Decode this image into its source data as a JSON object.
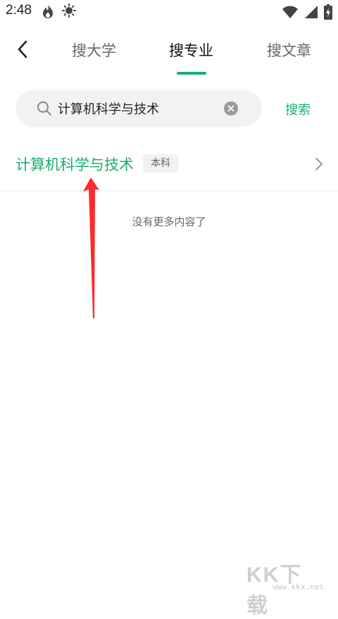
{
  "status_bar": {
    "time": "2:48"
  },
  "nav": {
    "tabs": [
      {
        "label": "搜大学",
        "active": false
      },
      {
        "label": "搜专业",
        "active": true
      },
      {
        "label": "搜文章",
        "active": false
      }
    ]
  },
  "search": {
    "value": "计算机科学与技术",
    "button_label": "搜索"
  },
  "results": [
    {
      "title": "计算机科学与技术",
      "badge": "本科"
    }
  ],
  "end_message": "没有更多内容了",
  "watermark": {
    "logo": "KK下载",
    "url": "www.kkx.net"
  },
  "colors": {
    "accent": "#1aae6f",
    "annotation": "#ff2a2a"
  },
  "icons": {
    "status_left": [
      "flame-icon",
      "brightness-icon"
    ],
    "status_right": [
      "wifi-icon",
      "signal-icon",
      "battery-icon"
    ],
    "nav": "back-chevron-icon",
    "search": "search-icon",
    "clear": "clear-circle-icon",
    "result": "chevron-right-icon"
  }
}
